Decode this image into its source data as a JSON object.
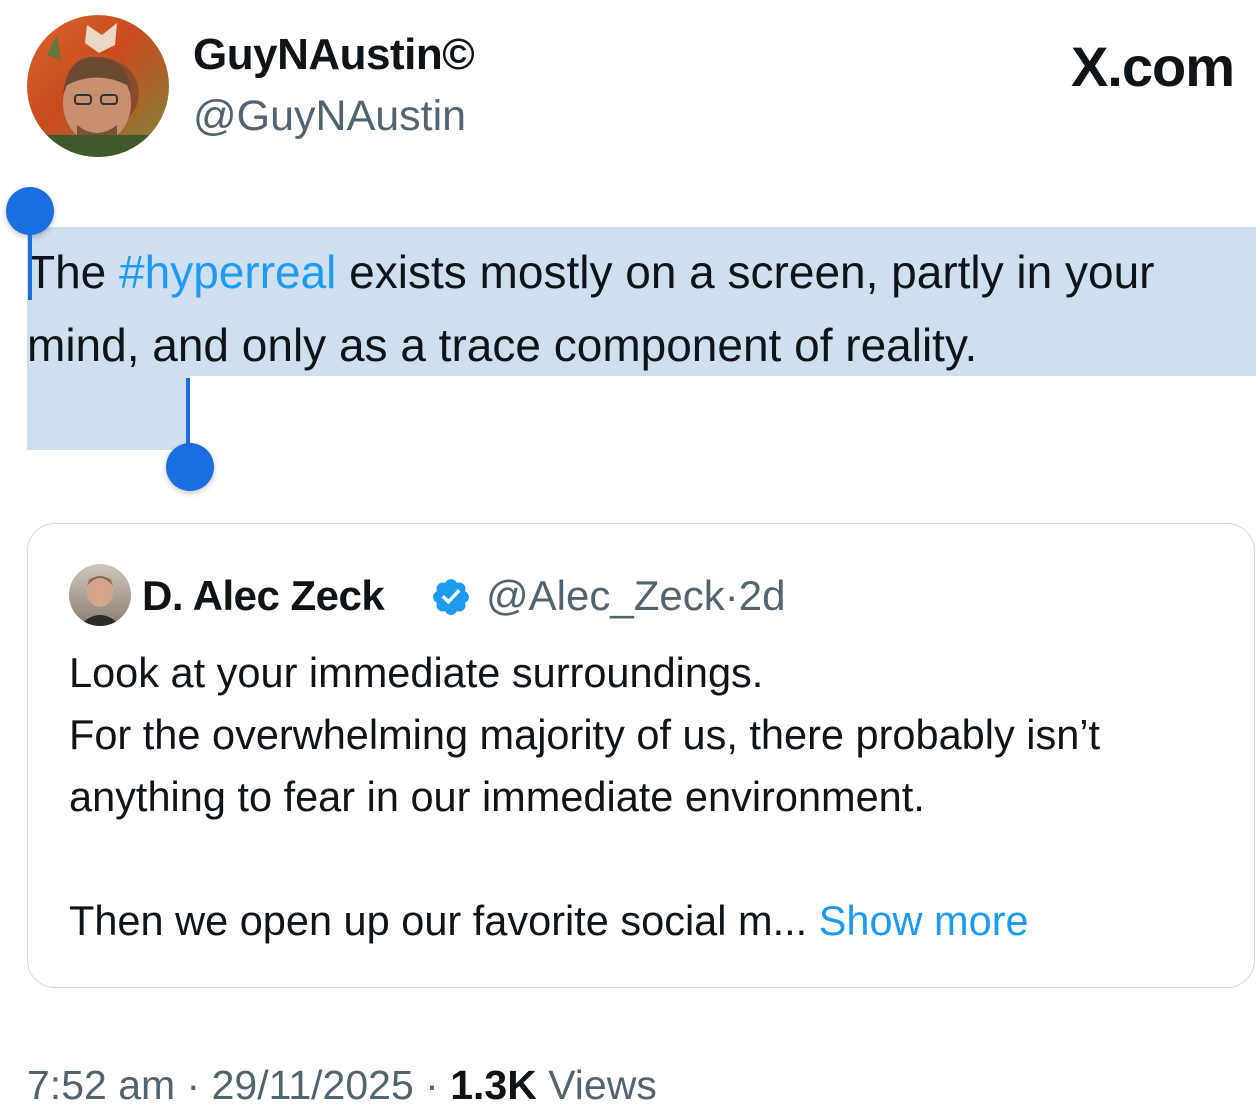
{
  "brand": {
    "site_label": "X.com",
    "accent_color": "#1d9bf0",
    "selection_color": "#cfdff0",
    "handle_color": "#1a6ee0"
  },
  "author": {
    "display_name": "GuyNAustin©",
    "handle": "@GuyNAustin",
    "avatar_icon": "profile-photo"
  },
  "tweet": {
    "text_before": "The ",
    "hashtag": "#hyperreal",
    "text_after": " exists mostly on a screen, partly in your mind, and only as a trace component of reality."
  },
  "quoted": {
    "display_name": "D. Alec Zeck",
    "verified_icon": "verified-badge-icon",
    "handle": "@Alec_Zeck",
    "separator": "·",
    "age": "2d",
    "body": "Look at your immediate surroundings.\nFor the overwhelming majority of us, there probably isn’t anything to fear in our immediate environment.\n\nThen we open up our favorite social m... ",
    "show_more": "Show more"
  },
  "meta": {
    "time": "7:52 am",
    "sep1": " · ",
    "date": "29/11/2025",
    "sep2": " · ",
    "views_count": "1.3K",
    "views_label": " Views"
  }
}
